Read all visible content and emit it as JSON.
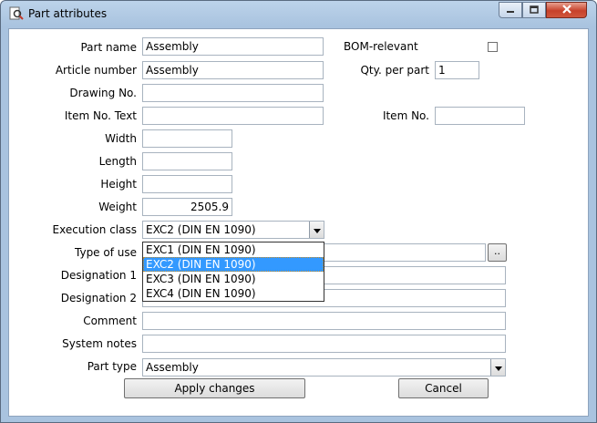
{
  "window": {
    "title": "Part attributes"
  },
  "labels": {
    "part_name": "Part name",
    "article_number": "Article number",
    "drawing_no": "Drawing No.",
    "item_no_text": "Item No. Text",
    "width": "Width",
    "length": "Length",
    "height": "Height",
    "weight": "Weight",
    "execution_class": "Execution class",
    "type_of_use": "Type of use",
    "designation_1": "Designation 1",
    "designation_2": "Designation 2",
    "comment": "Comment",
    "system_notes": "System notes",
    "part_type": "Part type",
    "bom_relevant": "BOM-relevant",
    "qty_per_part": "Qty. per part",
    "item_no": "Item No."
  },
  "values": {
    "part_name": "Assembly",
    "article_number": "Assembly",
    "drawing_no": "",
    "item_no_text": "",
    "width": "",
    "length": "",
    "height": "",
    "weight": "2505.9",
    "execution_class": "EXC2 (DIN EN 1090)",
    "type_of_use": "",
    "designation_1": "",
    "designation_2": "",
    "comment": "",
    "system_notes": "",
    "part_type": "Assembly",
    "qty_per_part": "1",
    "item_no": "",
    "bom_relevant": false
  },
  "execution_class_options": [
    "EXC1 (DIN EN 1090)",
    "EXC2 (DIN EN 1090)",
    "EXC3 (DIN EN 1090)",
    "EXC4 (DIN EN 1090)"
  ],
  "execution_class_selected_index": 1,
  "buttons": {
    "apply": "Apply changes",
    "cancel": "Cancel",
    "browse": ".."
  },
  "icons": {
    "app": "magnifier-document-icon",
    "minimize": "minimize-icon",
    "maximize": "maximize-icon",
    "close": "close-icon",
    "combo": "chevron-down-icon"
  }
}
